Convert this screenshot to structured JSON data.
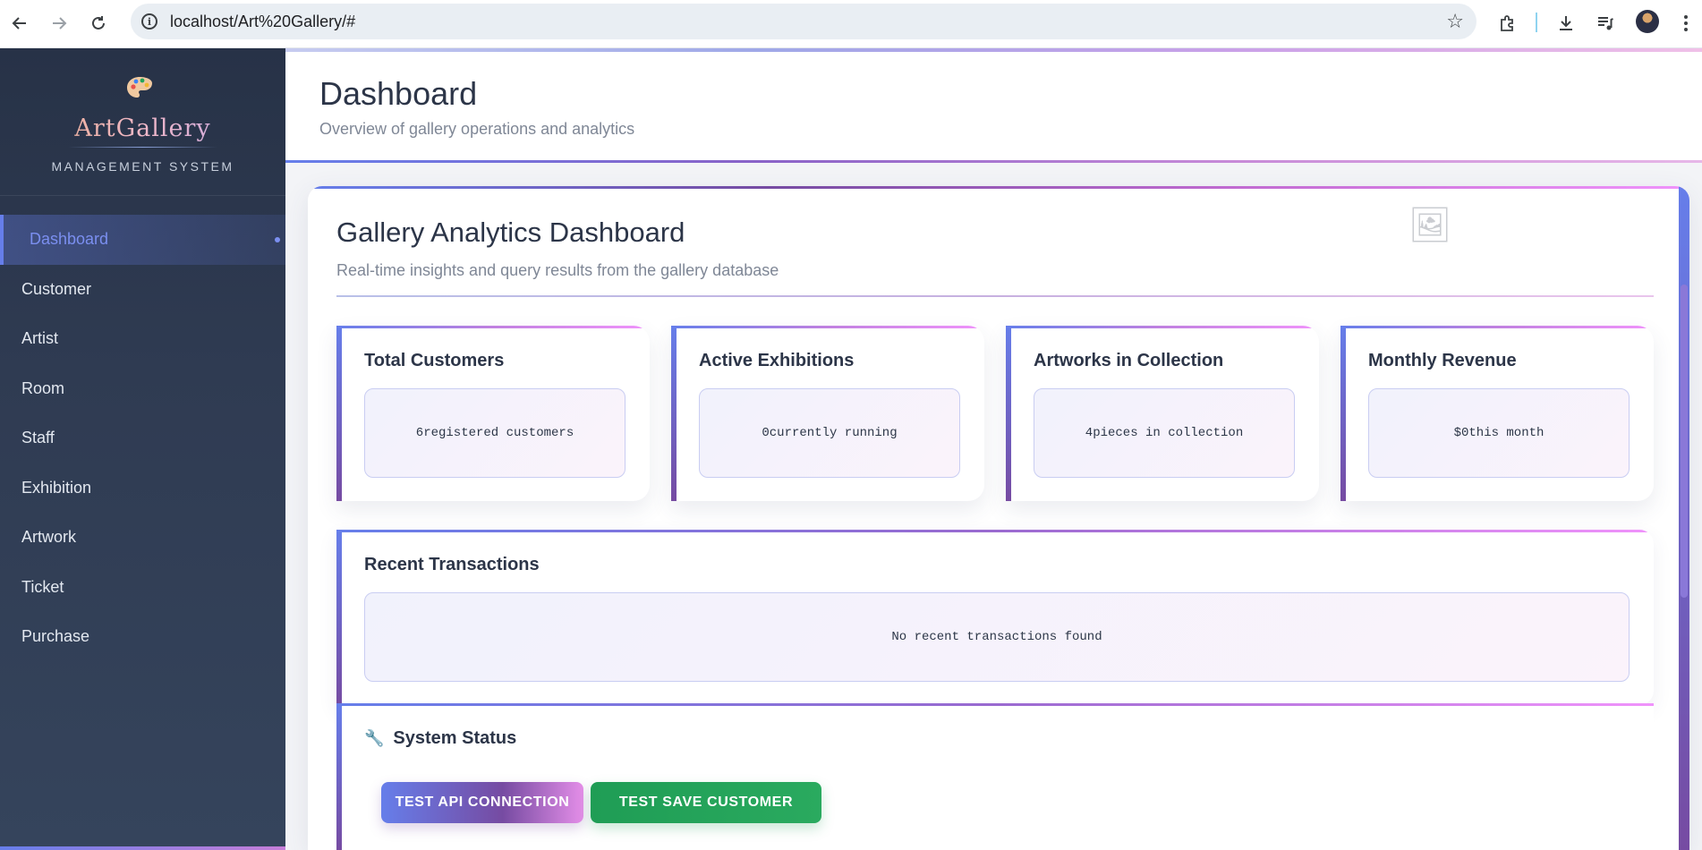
{
  "browser": {
    "url": "localhost/Art%20Gallery/#",
    "icons": [
      "back-icon",
      "forward-icon",
      "reload-icon",
      "site-info-icon",
      "star-icon",
      "extensions-icon",
      "download-icon",
      "media-icon",
      "menu-icon"
    ]
  },
  "sidebar": {
    "brand_title": "ArtGallery",
    "brand_subtitle": "MANAGEMENT SYSTEM",
    "items": [
      {
        "label": "Dashboard",
        "active": true
      },
      {
        "label": "Customer"
      },
      {
        "label": "Artist"
      },
      {
        "label": "Room"
      },
      {
        "label": "Staff"
      },
      {
        "label": "Exhibition"
      },
      {
        "label": "Artwork"
      },
      {
        "label": "Ticket"
      },
      {
        "label": "Purchase"
      }
    ]
  },
  "header": {
    "title": "Dashboard",
    "subtitle": "Overview of gallery operations and analytics"
  },
  "dashboard": {
    "title": "Gallery Analytics Dashboard",
    "subtitle": "Real-time insights and query results from the gallery database",
    "stats": [
      {
        "label": "Total Customers",
        "value": "6",
        "suffix": "registered customers"
      },
      {
        "label": "Active Exhibitions",
        "value": "0",
        "suffix": "currently running"
      },
      {
        "label": "Artworks in Collection",
        "value": "4",
        "suffix": "pieces in collection"
      },
      {
        "label": "Monthly Revenue",
        "value": "$0",
        "suffix": "this month"
      }
    ],
    "transactions": {
      "title": "Recent Transactions",
      "empty_text": "No recent transactions found"
    },
    "system_status": {
      "title": "System Status",
      "buttons": {
        "test_api": "TEST API CONNECTION",
        "test_save": "TEST SAVE CUSTOMER"
      }
    }
  },
  "colors": {
    "accent": "#667eea",
    "accent_2": "#764ba2",
    "pink": "#f093fb",
    "success": "#1f9d55",
    "sidebar_bg": "#2f3b52"
  }
}
